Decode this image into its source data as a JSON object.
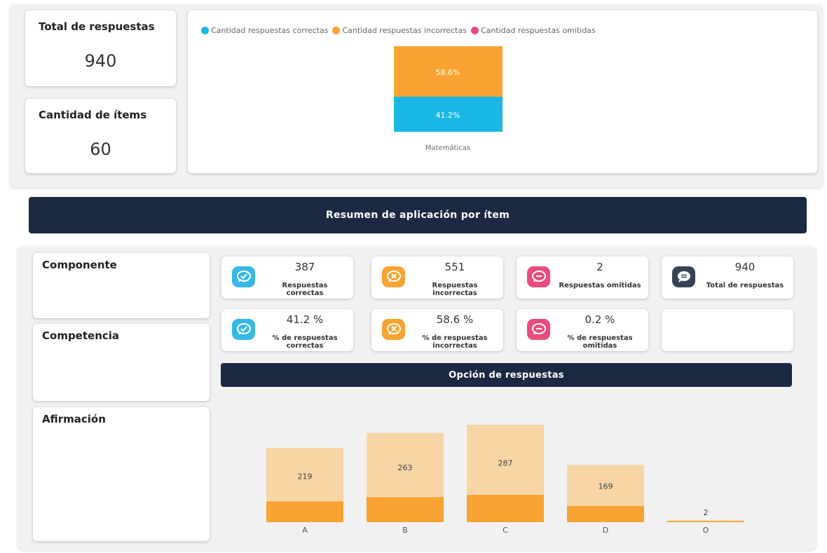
{
  "kpis": {
    "total_label": "Total de respuestas",
    "total_value": "940",
    "items_label": "Cantidad de ítems",
    "items_value": "60"
  },
  "stacked_chart": {
    "legend": [
      {
        "label": "Cantidad respuestas correctas",
        "color": "#1ab7e6"
      },
      {
        "label": "Cantidad respuestas incorrectas",
        "color": "#f8a332"
      },
      {
        "label": "Cantidad respuestas omitidas",
        "color": "#ea4d7c"
      }
    ],
    "incorrect_label": "58.6%",
    "correct_label": "41.2%",
    "category": "Matemáticas"
  },
  "summary_banner": "Resumen de aplicación por ítem",
  "side_panels": {
    "componente": "Componente",
    "competencia": "Competencia",
    "afirmacion": "Afirmación"
  },
  "stats": {
    "correct_count": {
      "value": "387",
      "label": "Respuestas correctas",
      "icon": "check-chat-icon",
      "color": "#37b8e6"
    },
    "incorrect_count": {
      "value": "551",
      "label": "Respuestas incorrectas",
      "icon": "x-chat-icon",
      "color": "#f8a332"
    },
    "omitted_count": {
      "value": "2",
      "label": "Respuestas omitidas",
      "icon": "minus-chat-icon",
      "color": "#ea4d7c"
    },
    "total_count": {
      "value": "940",
      "label": "Total de respuestas",
      "icon": "message-icon",
      "color": "#364456"
    },
    "correct_pct": {
      "value": "41.2 %",
      "label": "% de respuestas correctas",
      "icon": "check-chat-icon",
      "color": "#37b8e6"
    },
    "incorrect_pct": {
      "value": "58.6 %",
      "label": "% de respuestas incorrectas",
      "icon": "x-chat-icon",
      "color": "#f8a332"
    },
    "omitted_pct": {
      "value": "0.2 %",
      "label": "% de respuestas omitidas",
      "icon": "minus-chat-icon",
      "color": "#ea4d7c"
    }
  },
  "options_banner": "Opción de respuestas",
  "chart_data": [
    {
      "type": "bar",
      "categories": [
        "Matemáticas"
      ],
      "stacked": true,
      "series": [
        {
          "name": "Cantidad respuestas correctas",
          "values": [
            41.2
          ],
          "color": "#1ab7e6"
        },
        {
          "name": "Cantidad respuestas incorrectas",
          "values": [
            58.6
          ],
          "color": "#f8a332"
        },
        {
          "name": "Cantidad respuestas omitidas",
          "values": [
            0.2
          ],
          "color": "#ea4d7c"
        }
      ],
      "grid": false,
      "legend": "top-left"
    },
    {
      "type": "bar",
      "categories": [
        "A",
        "B",
        "C",
        "D",
        "O"
      ],
      "values": [
        219,
        263,
        287,
        169,
        2
      ],
      "light_color": "#f7d5a5",
      "dark_color": "#f8a332",
      "dark_share": 0.28,
      "ylim": [
        0,
        310
      ],
      "grid": false
    }
  ]
}
